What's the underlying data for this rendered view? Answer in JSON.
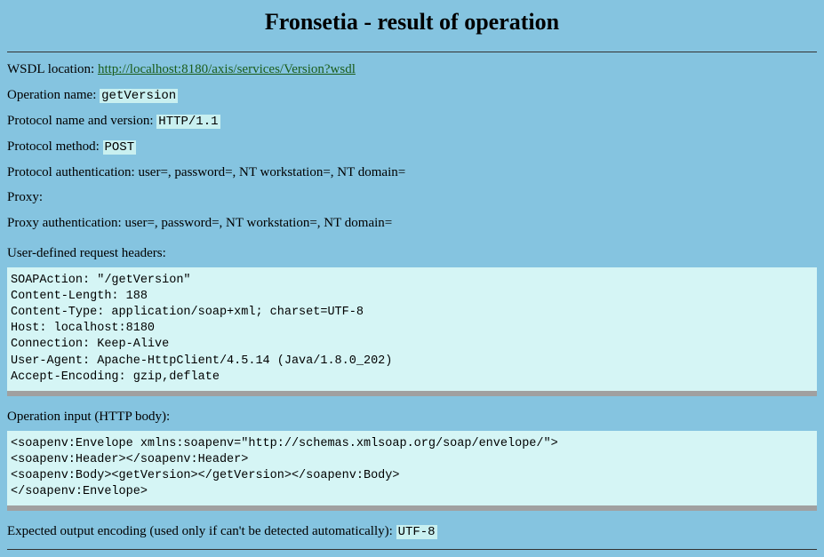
{
  "title": "Fronsetia - result of operation",
  "wsdl": {
    "label": "WSDL location: ",
    "url": "http://localhost:8180/axis/services/Version?wsdl"
  },
  "operation_name": {
    "label": "Operation name: ",
    "value": "getVersion"
  },
  "protocol_version": {
    "label": "Protocol name and version: ",
    "value": "HTTP/1.1"
  },
  "protocol_method": {
    "label": "Protocol method: ",
    "value": "POST"
  },
  "protocol_auth": {
    "label": "Protocol authentication: user=, password=, NT workstation=, NT domain="
  },
  "proxy": {
    "label": "Proxy:"
  },
  "proxy_auth": {
    "label": "Proxy authentication: user=, password=, NT workstation=, NT domain="
  },
  "request_headers": {
    "label": "User-defined request headers:",
    "value": "SOAPAction: \"/getVersion\"\nContent-Length: 188\nContent-Type: application/soap+xml; charset=UTF-8\nHost: localhost:8180\nConnection: Keep-Alive\nUser-Agent: Apache-HttpClient/4.5.14 (Java/1.8.0_202)\nAccept-Encoding: gzip,deflate"
  },
  "operation_input": {
    "label": "Operation input (HTTP body):",
    "value": "<soapenv:Envelope xmlns:soapenv=\"http://schemas.xmlsoap.org/soap/envelope/\">\n<soapenv:Header></soapenv:Header>\n<soapenv:Body><getVersion></getVersion></soapenv:Body>\n</soapenv:Envelope>"
  },
  "expected_encoding": {
    "label": "Expected output encoding (used only if can't be detected automatically): ",
    "value": "UTF-8"
  }
}
